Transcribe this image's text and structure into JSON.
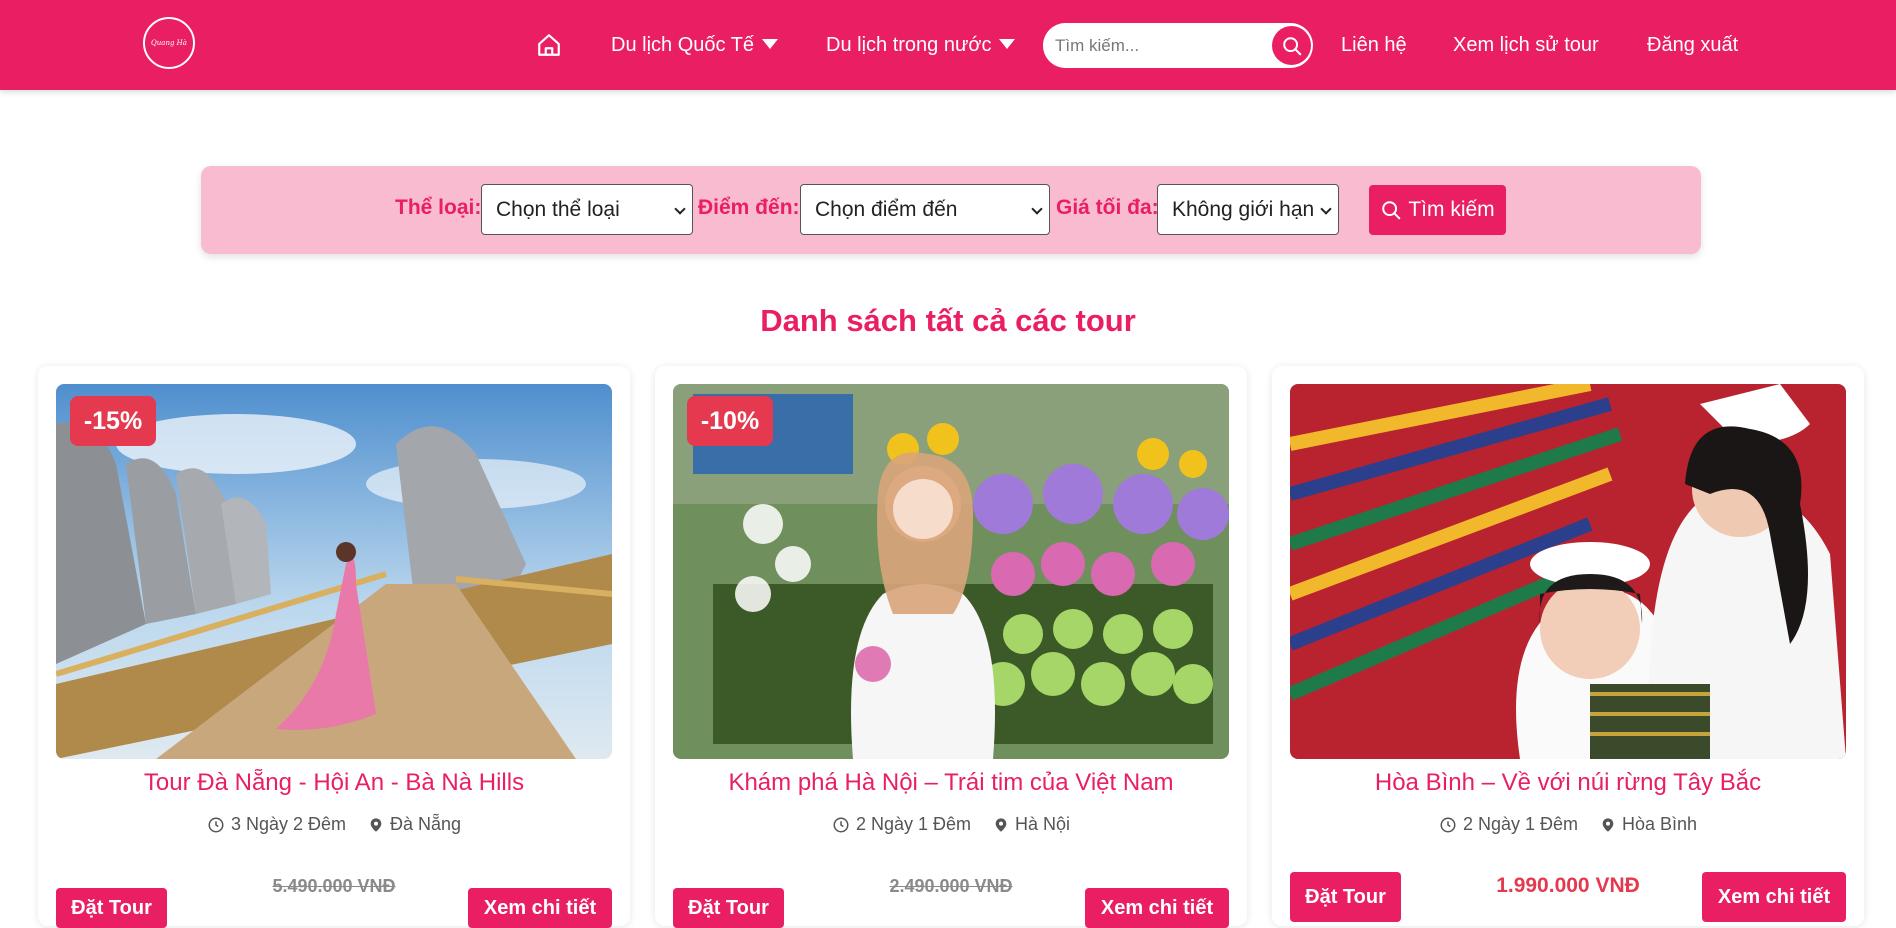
{
  "header": {
    "logo_text": "Quang Hà",
    "nav": {
      "international": "Du lịch Quốc Tế",
      "domestic": "Du lịch trong nước",
      "contact": "Liên hệ",
      "history": "Xem lịch sử tour",
      "logout": "Đăng xuất"
    },
    "search": {
      "placeholder": "Tìm kiếm..."
    }
  },
  "filter": {
    "category_label": "Thể loại:",
    "category_value": "Chọn thể loại",
    "destination_label": "Điểm đến:",
    "destination_value": "Chọn điểm đến",
    "max_price_label": "Giá tối đa:",
    "max_price_value": "Không giới hạn",
    "search_button": "Tìm kiếm"
  },
  "section_title": "Danh sách tất cả các tour",
  "tours": [
    {
      "badge": "-15%",
      "title": "Tour Đà Nẵng - Hội An - Bà Nà Hills",
      "duration": "3 Ngày 2 Đêm",
      "location": "Đà Nẵng",
      "old_price": "5.490.000 VNĐ",
      "book_label": "Đặt Tour",
      "detail_label": "Xem chi tiết"
    },
    {
      "badge": "-10%",
      "title": "Khám phá Hà Nội – Trái tim của Việt Nam",
      "duration": "2 Ngày 1 Đêm",
      "location": "Hà Nội",
      "old_price": "2.490.000 VNĐ",
      "book_label": "Đặt Tour",
      "detail_label": "Xem chi tiết"
    },
    {
      "title": "Hòa Bình – Về với núi rừng Tây Bắc",
      "duration": "2 Ngày 1 Đêm",
      "location": "Hòa Bình",
      "price": "1.990.000 VNĐ",
      "book_label": "Đặt Tour",
      "detail_label": "Xem chi tiết"
    }
  ],
  "colors": {
    "brand": "#e91e63",
    "filter_bg": "#f8bbd0",
    "discount": "#e53950"
  }
}
